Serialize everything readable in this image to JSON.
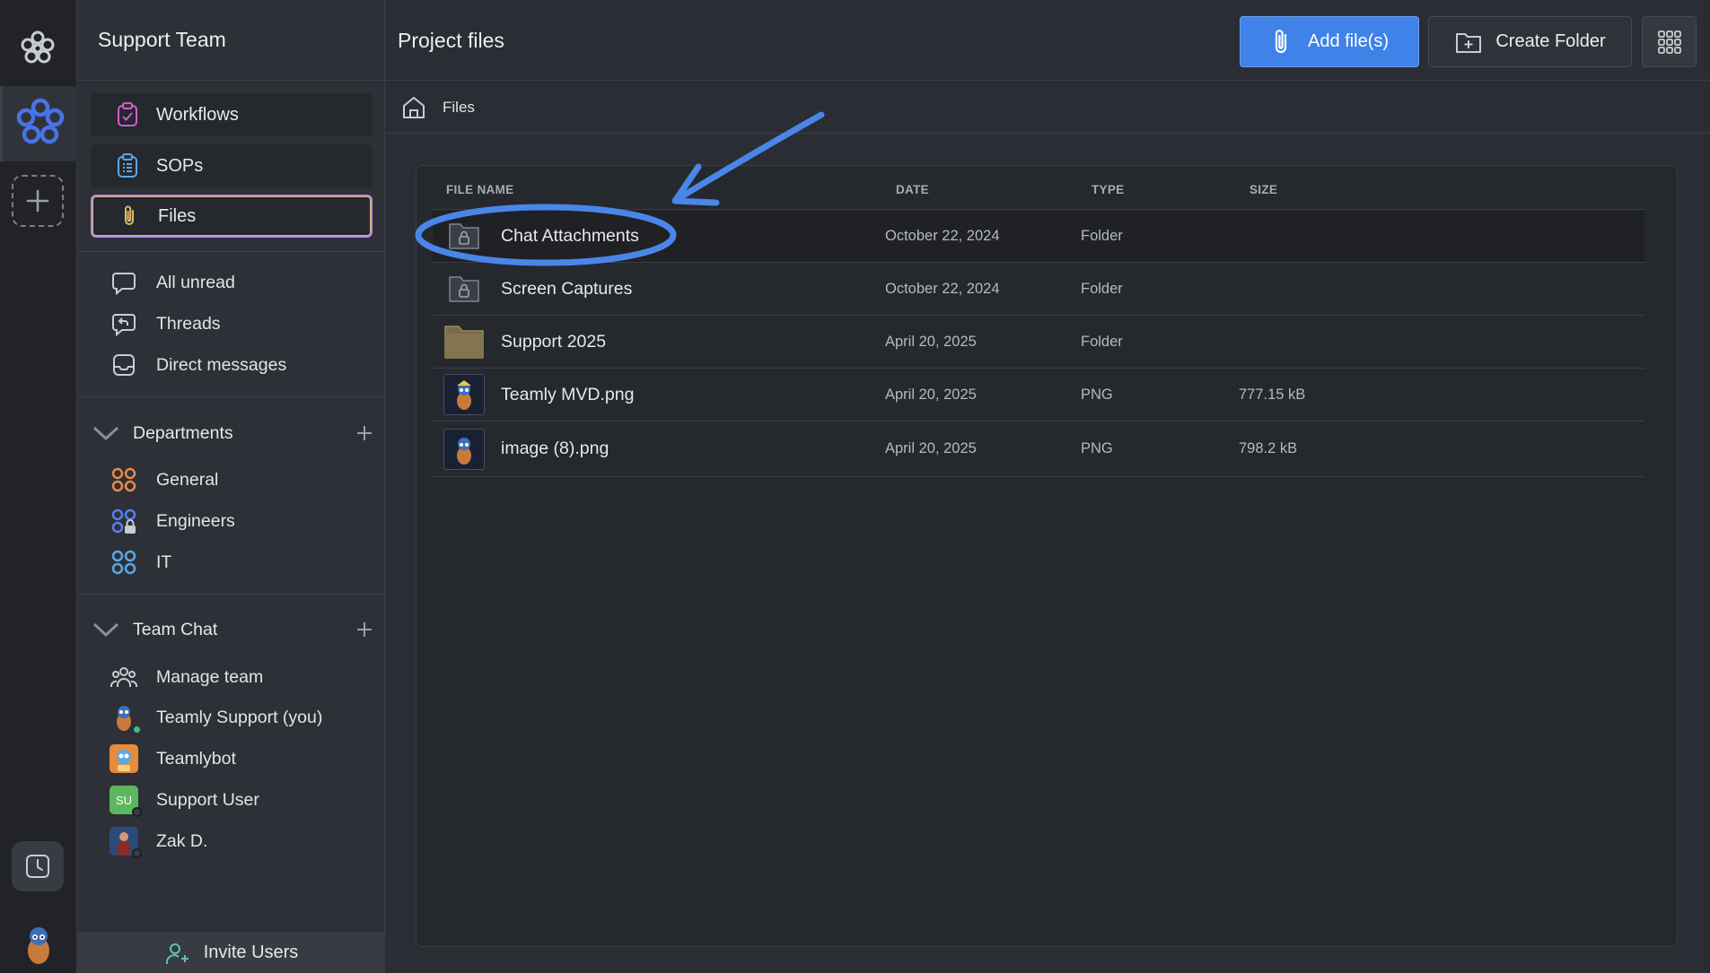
{
  "rail": {
    "logo_icon": "teamly-logo-icon",
    "active_workspace_icon": "workspace-flower-icon",
    "add_icon": "plus-icon",
    "clock_icon": "clock-icon",
    "avatar_icon": "user-avatar-icon"
  },
  "sidebar": {
    "title": "Support Team",
    "nav": [
      {
        "label": "Workflows",
        "icon": "clipboard-check-icon"
      },
      {
        "label": "SOPs",
        "icon": "clipboard-list-icon"
      },
      {
        "label": "Files",
        "icon": "paperclip-icon"
      }
    ],
    "messages": [
      {
        "label": "All unread",
        "icon": "chat-bubble-icon"
      },
      {
        "label": "Threads",
        "icon": "threads-icon"
      },
      {
        "label": "Direct messages",
        "icon": "inbox-icon"
      }
    ],
    "departments": {
      "title": "Departments",
      "items": [
        {
          "label": "General",
          "icon": "channel-grid-icon",
          "color": "#e8894a"
        },
        {
          "label": "Engineers",
          "icon": "channel-grid-lock-icon",
          "color": "#5a7ef0"
        },
        {
          "label": "IT",
          "icon": "channel-grid-icon",
          "color": "#5aa8e8"
        }
      ]
    },
    "team_chat": {
      "title": "Team Chat",
      "items": [
        {
          "label": "Manage team",
          "icon": "team-icon"
        },
        {
          "label": "Teamly Support (you)",
          "icon": "mascot-avatar-icon",
          "status": "#3bbf8e"
        },
        {
          "label": "Teamlybot",
          "icon": "bot-avatar-icon"
        },
        {
          "label": "Support User",
          "initials": "SU",
          "status": "#3a3d44"
        },
        {
          "label": "Zak D.",
          "icon": "photo-avatar-icon",
          "status": "#3a3d44"
        }
      ]
    },
    "invite_label": "Invite Users"
  },
  "main": {
    "title": "Project files",
    "add_files_label": "Add file(s)",
    "create_folder_label": "Create Folder",
    "breadcrumb": "Files",
    "columns": [
      "FILE NAME",
      "DATE",
      "TYPE",
      "SIZE"
    ],
    "rows": [
      {
        "name": "Chat Attachments",
        "date": "October 22, 2024",
        "type": "Folder",
        "size": "",
        "icon": "locked-folder-icon"
      },
      {
        "name": "Screen Captures",
        "date": "October 22, 2024",
        "type": "Folder",
        "size": "",
        "icon": "locked-folder-icon"
      },
      {
        "name": "Support 2025",
        "date": "April 20, 2025",
        "type": "Folder",
        "size": "",
        "icon": "folder-icon"
      },
      {
        "name": "Teamly MVD.png",
        "date": "April 20, 2025",
        "type": "PNG",
        "size": "777.15 kB",
        "icon": "image-thumbnail-icon"
      },
      {
        "name": "image (8).png",
        "date": "April 20, 2025",
        "type": "PNG",
        "size": "798.2 kB",
        "icon": "image-thumbnail-icon"
      }
    ]
  },
  "colors": {
    "accent_blue": "#3f82e8",
    "annotation_blue": "#4a86e8",
    "active_border": "#b48ee8"
  }
}
